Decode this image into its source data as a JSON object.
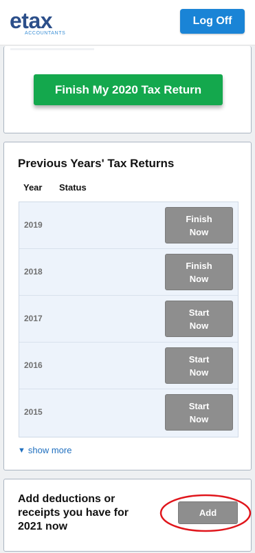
{
  "header": {
    "logo_main": "etax",
    "logo_sub": "ACCOUNTANTS",
    "logoff_label": "Log Off"
  },
  "current_return": {
    "finish_label": "Finish My 2020 Tax Return"
  },
  "previous_returns": {
    "title": "Previous Years' Tax Returns",
    "columns": [
      "Year",
      "Status"
    ],
    "rows": [
      {
        "year": "2019",
        "action": "Finish\nNow"
      },
      {
        "year": "2018",
        "action": "Finish\nNow"
      },
      {
        "year": "2017",
        "action": "Start\nNow"
      },
      {
        "year": "2016",
        "action": "Start\nNow"
      },
      {
        "year": "2015",
        "action": "Start\nNow"
      }
    ],
    "show_more_label": "show more"
  },
  "deductions": {
    "text": "Add deductions or receipts you have for 2021 now",
    "add_label": "Add"
  },
  "colors": {
    "brand_blue": "#2c4f8a",
    "logoff_blue": "#1a84d6",
    "finish_green": "#14a84d",
    "button_gray": "#8e8e8e",
    "highlight_red": "#e0151b"
  }
}
